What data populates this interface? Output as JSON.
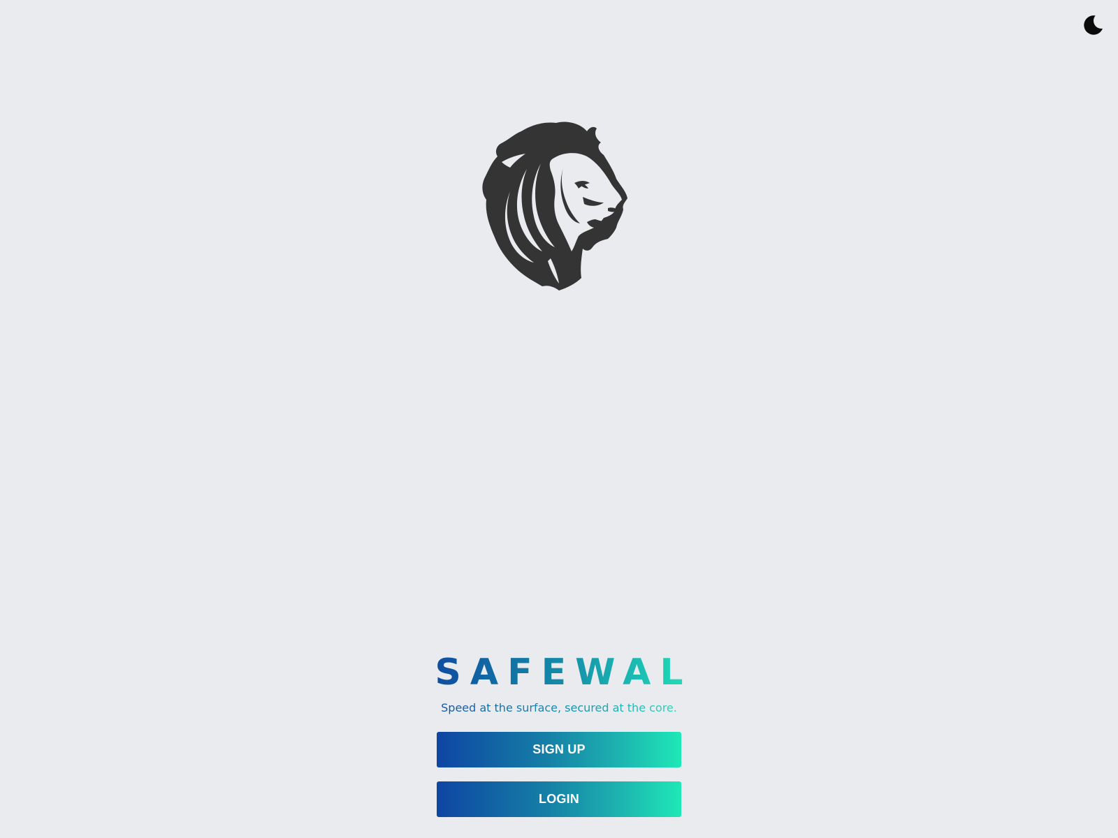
{
  "header": {
    "theme_toggle_icon": "moon-icon"
  },
  "logo": {
    "icon": "lion-head-icon",
    "color": "#343434"
  },
  "brand": {
    "title": "SAFEWAL",
    "tagline": "Speed at the surface, secured at the core."
  },
  "actions": {
    "signup_label": "SIGN UP",
    "login_label": "LOGIN"
  },
  "colors": {
    "background": "#e9ebef",
    "gradient_start": "#0e45a3",
    "gradient_end": "#1ee8b6"
  }
}
